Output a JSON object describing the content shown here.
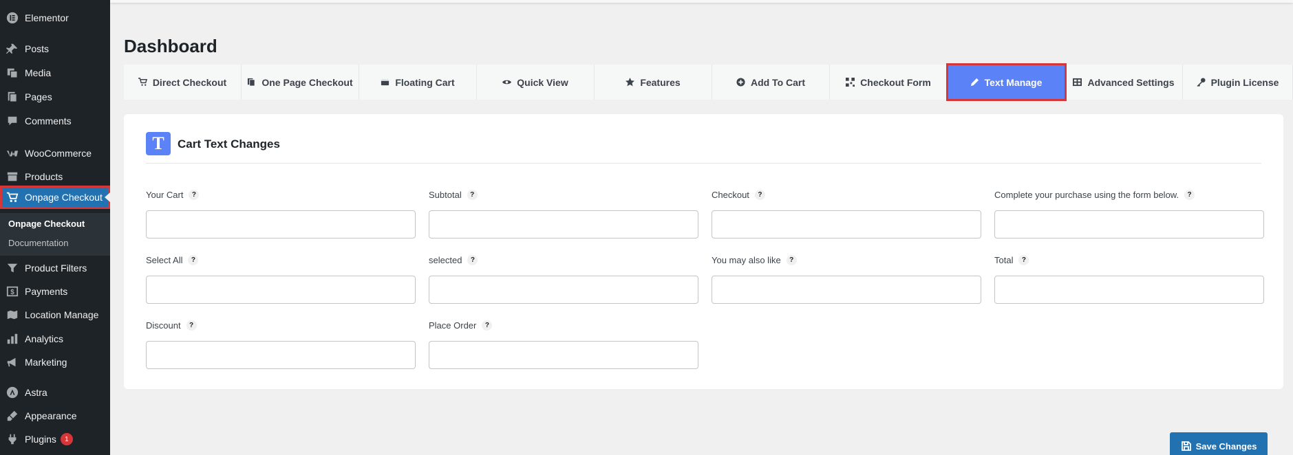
{
  "sidebar": {
    "items": [
      {
        "label": "Elementor",
        "icon": "elementor-icon"
      },
      {
        "label": "Posts",
        "icon": "pin-icon"
      },
      {
        "label": "Media",
        "icon": "media-icon"
      },
      {
        "label": "Pages",
        "icon": "pages-icon"
      },
      {
        "label": "Comments",
        "icon": "comment-icon"
      },
      {
        "label": "WooCommerce",
        "icon": "woocommerce-icon"
      },
      {
        "label": "Products",
        "icon": "archive-icon"
      },
      {
        "label": "Onpage Checkout",
        "icon": "cart-icon"
      },
      {
        "label": "Product Filters",
        "icon": "filter-icon"
      },
      {
        "label": "Payments",
        "icon": "dollar-icon"
      },
      {
        "label": "Location Manage",
        "icon": "location-icon"
      },
      {
        "label": "Analytics",
        "icon": "chart-bar-icon"
      },
      {
        "label": "Marketing",
        "icon": "megaphone-icon"
      },
      {
        "label": "Astra",
        "icon": "astra-icon"
      },
      {
        "label": "Appearance",
        "icon": "brush-icon"
      },
      {
        "label": "Plugins",
        "icon": "plug-icon",
        "badge": "1"
      }
    ],
    "submenu": {
      "current": "Onpage Checkout",
      "documentation": "Documentation"
    }
  },
  "page": {
    "title": "Dashboard"
  },
  "tabs": [
    {
      "label": "Direct Checkout",
      "icon": "cart-icon"
    },
    {
      "label": "One Page Checkout",
      "icon": "copy-icon"
    },
    {
      "label": "Floating Cart",
      "icon": "wallet-icon"
    },
    {
      "label": "Quick View",
      "icon": "eye-icon"
    },
    {
      "label": "Features",
      "icon": "star-icon"
    },
    {
      "label": "Add To Cart",
      "icon": "plus-circle-icon"
    },
    {
      "label": "Checkout Form",
      "icon": "qr-icon"
    },
    {
      "label": "Text Manage",
      "icon": "pencil-icon"
    },
    {
      "label": "Advanced Settings",
      "icon": "table-icon"
    },
    {
      "label": "Plugin License",
      "icon": "key-icon"
    }
  ],
  "card": {
    "icon_letter": "T",
    "title": "Cart Text Changes",
    "help_symbol": "?",
    "fields": [
      {
        "label": "Your Cart",
        "value": ""
      },
      {
        "label": "Subtotal",
        "value": ""
      },
      {
        "label": "Checkout",
        "value": ""
      },
      {
        "label": "Complete your purchase using the form below.",
        "value": ""
      },
      {
        "label": "Select All",
        "value": ""
      },
      {
        "label": "selected",
        "value": ""
      },
      {
        "label": "You may also like",
        "value": ""
      },
      {
        "label": "Total",
        "value": ""
      },
      {
        "label": "Discount",
        "value": ""
      },
      {
        "label": "Place Order",
        "value": ""
      }
    ]
  },
  "actions": {
    "save_label": "Save Changes"
  },
  "colors": {
    "sidebar_bg": "#1d2327",
    "active_menu": "#2271b1",
    "active_tab": "#5b82f6",
    "highlight_outline": "#d63638",
    "save_button": "#2271b1"
  }
}
